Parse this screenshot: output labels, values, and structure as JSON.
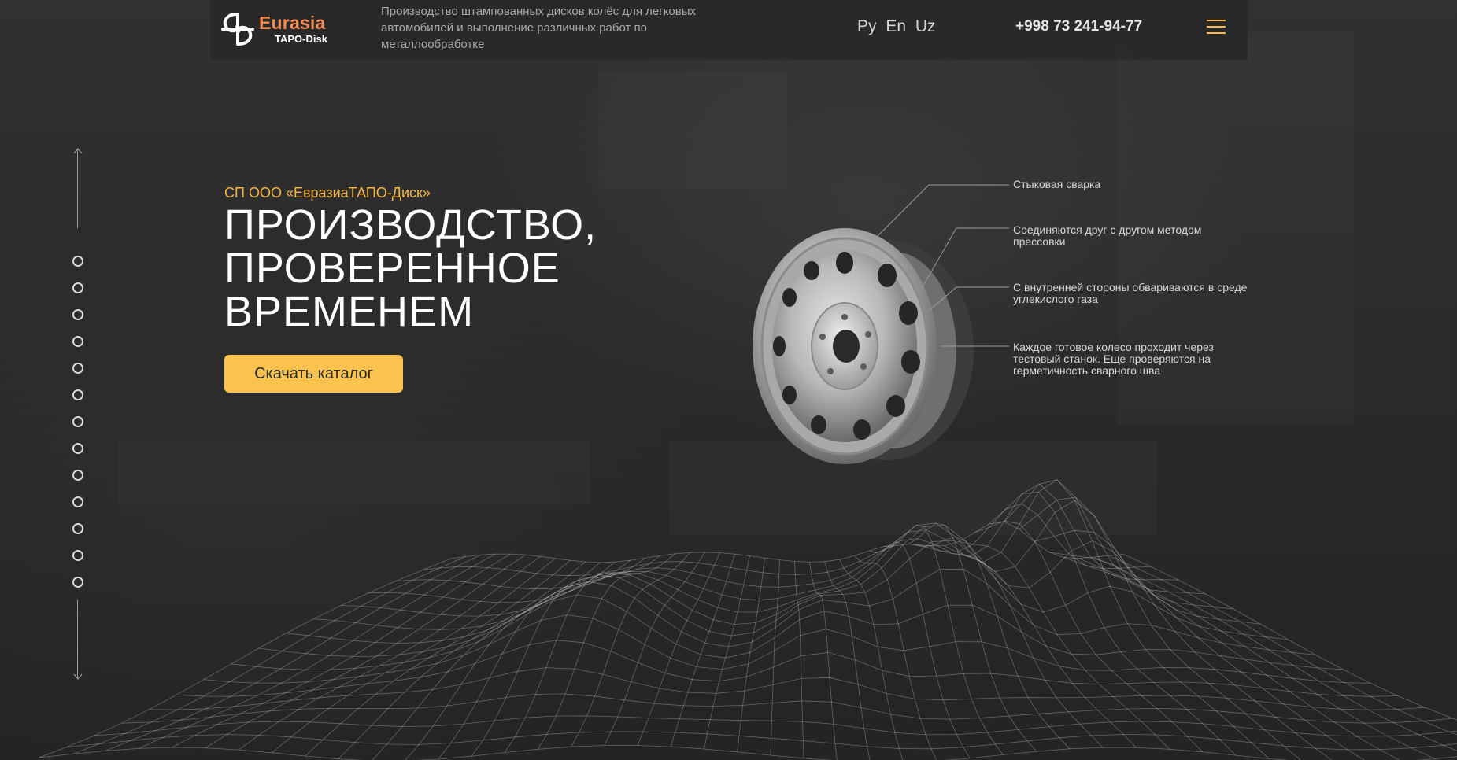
{
  "header": {
    "logo": {
      "name": "Eurasia",
      "subname": "TAPO-Disk"
    },
    "tagline": "Производство штампованных дисков колёс для легковых автомобилей и выполнение различных работ по металлообработке",
    "languages": [
      "Ру",
      "En",
      "Uz"
    ],
    "phone": "+998 73 241-94-77",
    "menu_icon": "hamburger-menu-icon",
    "accent_color": "#f6b640"
  },
  "hero": {
    "company": "СП ООО «ЕвразиаТАПО-Диск»",
    "headline": [
      "ПРОИЗВОДСТВО,",
      "ПРОВЕРЕННОЕ",
      "ВРЕМЕНЕМ"
    ],
    "cta_label": "Скачать каталог",
    "cta_color": "#fcc24e"
  },
  "callouts": [
    "Стыковая сварка",
    "Соединяются друг с другом методом прессовки",
    "С внутренней стороны обвариваются в среде углекислого газа",
    "Каждое готовое колесо проходит через тестовый станок. Еще проверяются на герметичность сварного шва"
  ],
  "side_nav": {
    "dot_count": 13,
    "arrows": [
      "arrow-up-icon",
      "arrow-down-icon"
    ]
  }
}
